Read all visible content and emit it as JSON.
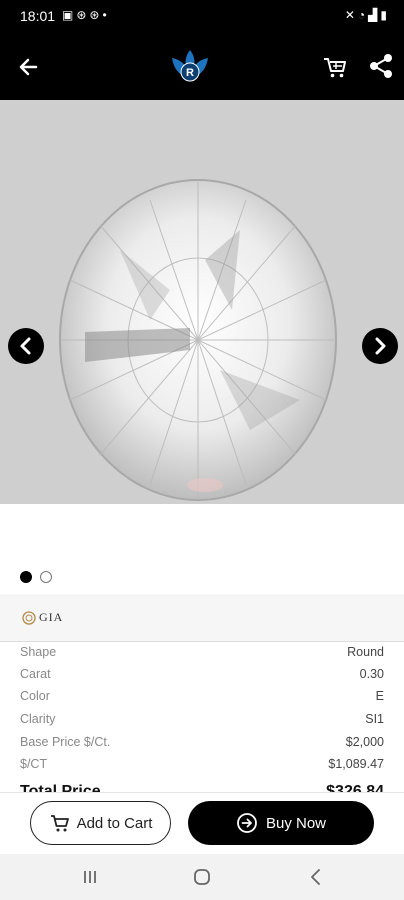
{
  "status_bar": {
    "time": "18:01",
    "left_icons": [
      "image-icon",
      "sync-icon",
      "sync-icon",
      "dot-icon"
    ],
    "right_icons": [
      "mute-icon",
      "wifi-icon",
      "signal-icon",
      "battery-icon"
    ]
  },
  "app_bar": {
    "logo_letter": "R",
    "logo_color": "#1e73be"
  },
  "gallery": {
    "background_color": "#cfcfcf",
    "current_index": 1,
    "total": 2
  },
  "certificate": {
    "label": "GIA"
  },
  "specs": [
    {
      "label": "Shape",
      "value": "Round"
    },
    {
      "label": "Carat",
      "value": "0.30"
    },
    {
      "label": "Color",
      "value": "E"
    },
    {
      "label": "Clarity",
      "value": "SI1"
    },
    {
      "label": "Base Price $/Ct.",
      "value": "$2,000"
    },
    {
      "label": "$/CT",
      "value": "$1,089.47"
    }
  ],
  "total": {
    "label": "Total Price",
    "value": "$326.84"
  },
  "actions": {
    "add_to_cart": "Add to Cart",
    "buy_now": "Buy Now"
  }
}
